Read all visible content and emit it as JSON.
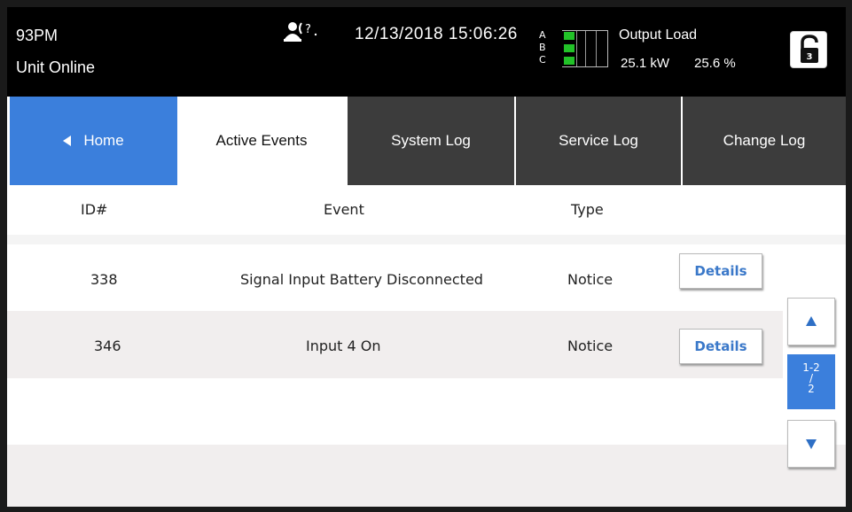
{
  "header": {
    "model": "93PM",
    "status": "Unit Online",
    "datetime": "12/13/2018 15:06:26",
    "phases": [
      "A",
      "B",
      "C"
    ],
    "output_label": "Output Load",
    "output_kw": "25.1 kW",
    "output_pct": "25.6 %",
    "person_icon": "person-help-icon",
    "lock_icon": "unlock-icon",
    "lock_level": "3",
    "phase_color": "#22c228"
  },
  "tabs": {
    "home": "Home",
    "active_events": "Active Events",
    "system_log": "System Log",
    "service_log": "Service Log",
    "change_log": "Change Log"
  },
  "table": {
    "columns": [
      "ID#",
      "Event",
      "Type"
    ],
    "rows": [
      {
        "id": "338",
        "event": "Signal Input Battery Disconnected",
        "type": "Notice",
        "action": "Details"
      },
      {
        "id": "346",
        "event": "Input 4 On",
        "type": "Notice",
        "action": "Details"
      }
    ]
  },
  "pager": {
    "range": "1-2",
    "slash": "/",
    "total": "2"
  },
  "colors": {
    "accent": "#3b7fdc",
    "tab_dark": "#3c3c3c",
    "link": "#3a78c9"
  }
}
